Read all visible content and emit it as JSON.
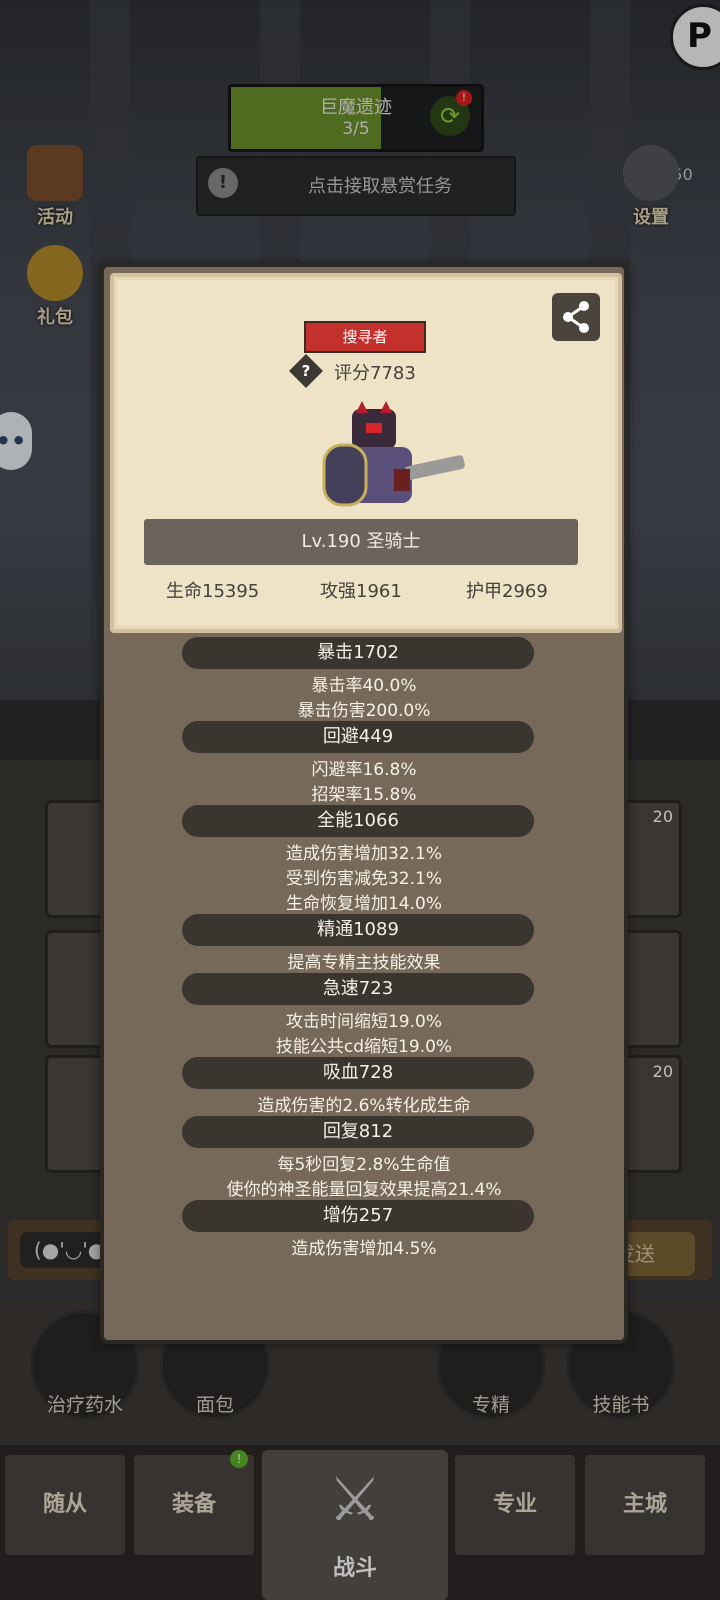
{
  "top": {
    "dungeon_name": "巨魔遗迹",
    "progress_text": "3/5",
    "progress": 0.6,
    "alert_badge": "!",
    "quest_prompt": "点击接取悬赏任务",
    "player_level": "Lv.350",
    "settings_label": "设置",
    "corner_letter": "P"
  },
  "side": {
    "activity_label": "活动",
    "gift_label": "礼包",
    "chat_icon": "chat-bubble-icon"
  },
  "slots": {
    "badge_a": "20",
    "badge_b": "20"
  },
  "chat": {
    "emote": "(●'◡'●",
    "send_label": "发送"
  },
  "consumables": {
    "potion": "治疗药水",
    "bread": "面包",
    "specialization": "专精",
    "skill_book": "技能书"
  },
  "nav": {
    "follower": "随从",
    "equipment": "装备",
    "battle": "战斗",
    "profession": "专业",
    "main_city": "主城",
    "notify_badge": "!"
  },
  "profile": {
    "role": "搜寻者",
    "score_label": "评分7783",
    "name_level": "Lv.190 圣骑士",
    "hp": "生命15395",
    "atk": "攻强1961",
    "armor": "护甲2969"
  },
  "stats": [
    {
      "head": "暴击1702",
      "subs": [
        "暴击率40.0%",
        "暴击伤害200.0%"
      ]
    },
    {
      "head": "回避449",
      "subs": [
        "闪避率16.8%",
        "招架率15.8%"
      ]
    },
    {
      "head": "全能1066",
      "subs": [
        "造成伤害增加32.1%",
        "受到伤害减免32.1%",
        "生命恢复增加14.0%"
      ]
    },
    {
      "head": "精通1089",
      "subs": [
        "提高专精主技能效果"
      ]
    },
    {
      "head": "急速723",
      "subs": [
        "攻击时间缩短19.0%",
        "技能公共cd缩短19.0%"
      ]
    },
    {
      "head": "吸血728",
      "subs": [
        "造成伤害的2.6%转化成生命"
      ]
    },
    {
      "head": "回复812",
      "subs": [
        "每5秒回复2.8%生命值",
        "使你的神圣能量回复效果提高21.4%"
      ]
    },
    {
      "head": "增伤257",
      "subs": [
        "造成伤害增加4.5%"
      ]
    }
  ],
  "colors": {
    "badge_red": "#c4302c",
    "panel": "#77695a",
    "card": "#efe3c7",
    "pill": "#3b3530"
  }
}
